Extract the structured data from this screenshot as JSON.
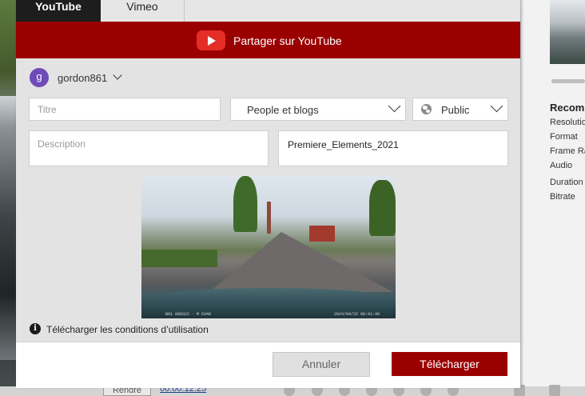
{
  "tabs": [
    {
      "label": "YouTube",
      "active": true
    },
    {
      "label": "Vimeo",
      "active": false
    }
  ],
  "banner": {
    "text": "Partager sur YouTube",
    "icon": "youtube-logo-icon",
    "color": "#9b0000"
  },
  "account": {
    "initial": "g",
    "name": "gordon861"
  },
  "form": {
    "title_placeholder": "Titre",
    "category": "People et blogs",
    "privacy": "Public",
    "description_placeholder": "Description",
    "tags_value": "Premiere_Elements_2021"
  },
  "preview": {
    "overlay_left": "B01 000322 · M 6348",
    "overlay_right": "2024/04/22 08:01:48"
  },
  "terms": {
    "icon": "info-icon",
    "text": "Télécharger les conditions d’utilisation"
  },
  "buttons": {
    "cancel": "Annuler",
    "upload": "Télécharger"
  },
  "background": {
    "reco_title": "Recom",
    "reco_items": [
      "Resolutio",
      "Format",
      "Frame Ra",
      "Audio",
      "Duration",
      "Bitrate"
    ],
    "render_label": "Rendre",
    "timecode": "00:00:12:25"
  }
}
